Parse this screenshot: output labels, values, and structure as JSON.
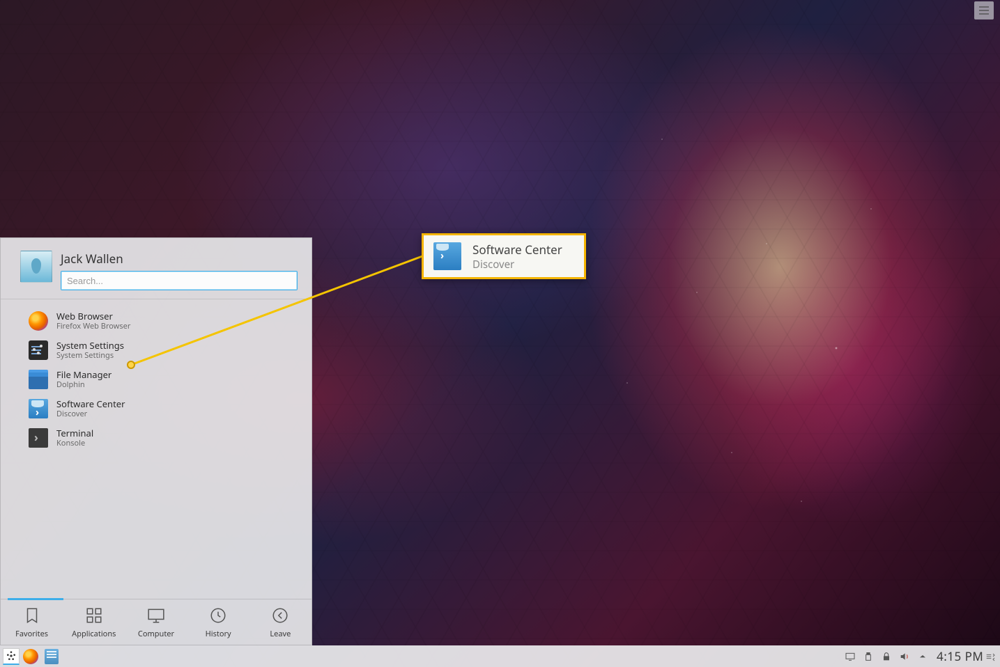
{
  "user": {
    "name": "Jack Wallen"
  },
  "search": {
    "placeholder": "Search..."
  },
  "favorites": [
    {
      "title": "Web Browser",
      "subtitle": "Firefox Web Browser",
      "icon": "firefox"
    },
    {
      "title": "System Settings",
      "subtitle": "System Settings",
      "icon": "settings"
    },
    {
      "title": "File Manager",
      "subtitle": "Dolphin",
      "icon": "folder"
    },
    {
      "title": "Software Center",
      "subtitle": "Discover",
      "icon": "discover"
    },
    {
      "title": "Terminal",
      "subtitle": "Konsole",
      "icon": "terminal"
    }
  ],
  "tabs": {
    "favorites": "Favorites",
    "applications": "Applications",
    "computer": "Computer",
    "history": "History",
    "leave": "Leave"
  },
  "callout": {
    "title": "Software Center",
    "subtitle": "Discover"
  },
  "clock": "4:15 PM"
}
